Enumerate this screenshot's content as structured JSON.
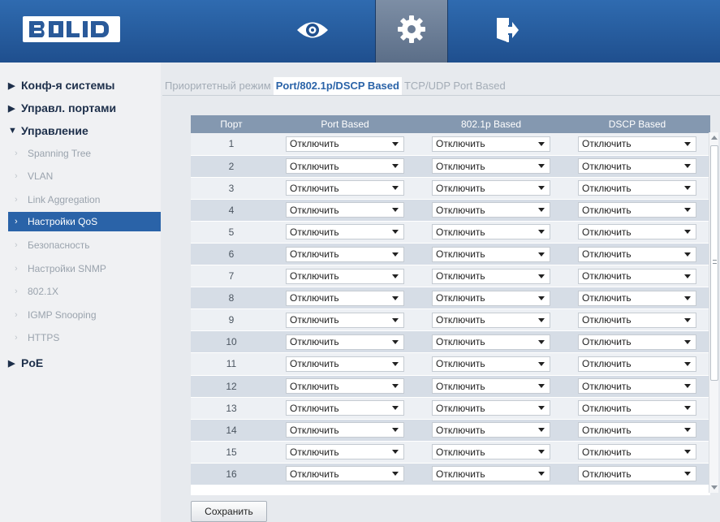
{
  "header": {
    "logo": "BOLID",
    "nav": [
      {
        "icon": "eye-icon"
      },
      {
        "icon": "gear-icon",
        "active": true
      },
      {
        "icon": "exit-icon"
      }
    ],
    "colors": {
      "header": "#2f6bb0",
      "active_nav": "#6b7d96",
      "accent": "#2a63a8"
    }
  },
  "sidebar": {
    "groups": [
      {
        "label": "Конф-я системы",
        "expanded": false
      },
      {
        "label": "Управл. портами",
        "expanded": false
      },
      {
        "label": "Управление",
        "expanded": true
      },
      {
        "label": "PoE",
        "expanded": false
      }
    ],
    "items": [
      {
        "label": "Spanning Tree"
      },
      {
        "label": "VLAN"
      },
      {
        "label": "Link Aggregation"
      },
      {
        "label": "Настройки QoS",
        "active": true
      },
      {
        "label": "Безопасность"
      },
      {
        "label": "Настройки SNMP"
      },
      {
        "label": "802.1X"
      },
      {
        "label": "IGMP Snooping"
      },
      {
        "label": "HTTPS"
      }
    ]
  },
  "tabs": [
    {
      "label": "Приоритетный режим"
    },
    {
      "label": "Port/802.1p/DSCP Based",
      "active": true
    },
    {
      "label": "TCP/UDP Port Based"
    }
  ],
  "table": {
    "headers": [
      "Порт",
      "Port Based",
      "802.1p Based",
      "DSCP Based"
    ],
    "rows": [
      {
        "port": "1",
        "port_based": "Отключить",
        "p8021": "Отключить",
        "dscp": "Отключить"
      },
      {
        "port": "2",
        "port_based": "Отключить",
        "p8021": "Отключить",
        "dscp": "Отключить"
      },
      {
        "port": "3",
        "port_based": "Отключить",
        "p8021": "Отключить",
        "dscp": "Отключить"
      },
      {
        "port": "4",
        "port_based": "Отключить",
        "p8021": "Отключить",
        "dscp": "Отключить"
      },
      {
        "port": "5",
        "port_based": "Отключить",
        "p8021": "Отключить",
        "dscp": "Отключить"
      },
      {
        "port": "6",
        "port_based": "Отключить",
        "p8021": "Отключить",
        "dscp": "Отключить"
      },
      {
        "port": "7",
        "port_based": "Отключить",
        "p8021": "Отключить",
        "dscp": "Отключить"
      },
      {
        "port": "8",
        "port_based": "Отключить",
        "p8021": "Отключить",
        "dscp": "Отключить"
      },
      {
        "port": "9",
        "port_based": "Отключить",
        "p8021": "Отключить",
        "dscp": "Отключить"
      },
      {
        "port": "10",
        "port_based": "Отключить",
        "p8021": "Отключить",
        "dscp": "Отключить"
      },
      {
        "port": "11",
        "port_based": "Отключить",
        "p8021": "Отключить",
        "dscp": "Отключить"
      },
      {
        "port": "12",
        "port_based": "Отключить",
        "p8021": "Отключить",
        "dscp": "Отключить"
      },
      {
        "port": "13",
        "port_based": "Отключить",
        "p8021": "Отключить",
        "dscp": "Отключить"
      },
      {
        "port": "14",
        "port_based": "Отключить",
        "p8021": "Отключить",
        "dscp": "Отключить"
      },
      {
        "port": "15",
        "port_based": "Отключить",
        "p8021": "Отключить",
        "dscp": "Отключить"
      },
      {
        "port": "16",
        "port_based": "Отключить",
        "p8021": "Отключить",
        "dscp": "Отключить"
      }
    ]
  },
  "save_label": "Сохранить"
}
